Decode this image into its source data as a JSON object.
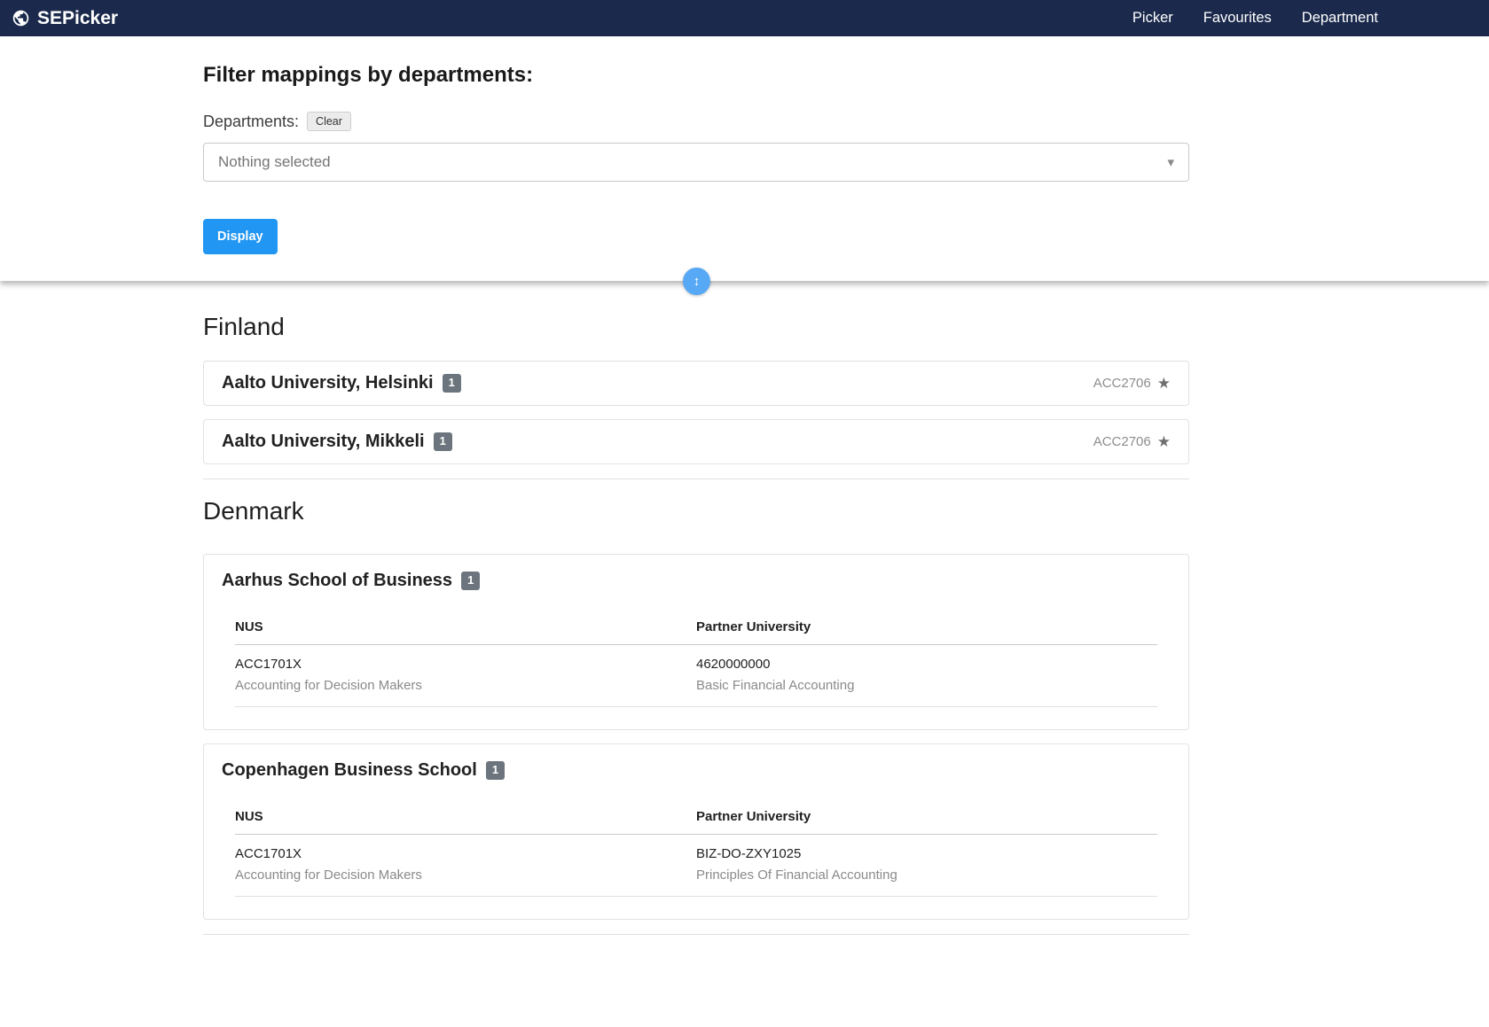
{
  "colors": {
    "navbar_bg": "#1b2a4c",
    "accent_blue": "#2196f3",
    "scroll_button_blue": "#57a8f5",
    "badge_gray": "#6c757d"
  },
  "icons": {
    "caret": "▾",
    "star": "★",
    "updown": "↕"
  },
  "navbar": {
    "brand": "SEPicker",
    "links": [
      {
        "label": "Picker"
      },
      {
        "label": "Favourites"
      },
      {
        "label": "Department"
      }
    ]
  },
  "filter": {
    "title": "Filter mappings by departments:",
    "departments_label": "Departments:",
    "clear_label": "Clear",
    "select_value": "Nothing selected",
    "display_label": "Display"
  },
  "sections": [
    {
      "country": "Finland",
      "universities": [
        {
          "name": "Aalto University, Helsinki",
          "count": "1",
          "code": "ACC2706"
        },
        {
          "name": "Aalto University, Mikkeli",
          "count": "1",
          "code": "ACC2706"
        }
      ]
    },
    {
      "country": "Denmark",
      "universities": [
        {
          "name": "Aarhus School of Business",
          "count": "1",
          "table": {
            "headers": [
              "NUS",
              "Partner University"
            ],
            "rows": [
              {
                "nus_code": "ACC1701X",
                "nus_title": "Accounting for Decision Makers",
                "partner_code": "4620000000",
                "partner_title": "Basic Financial Accounting"
              }
            ]
          }
        },
        {
          "name": "Copenhagen Business School",
          "count": "1",
          "table": {
            "headers": [
              "NUS",
              "Partner University"
            ],
            "rows": [
              {
                "nus_code": "ACC1701X",
                "nus_title": "Accounting for Decision Makers",
                "partner_code": "BIZ-DO-ZXY1025",
                "partner_title": "Principles Of Financial Accounting"
              }
            ]
          }
        }
      ]
    }
  ]
}
